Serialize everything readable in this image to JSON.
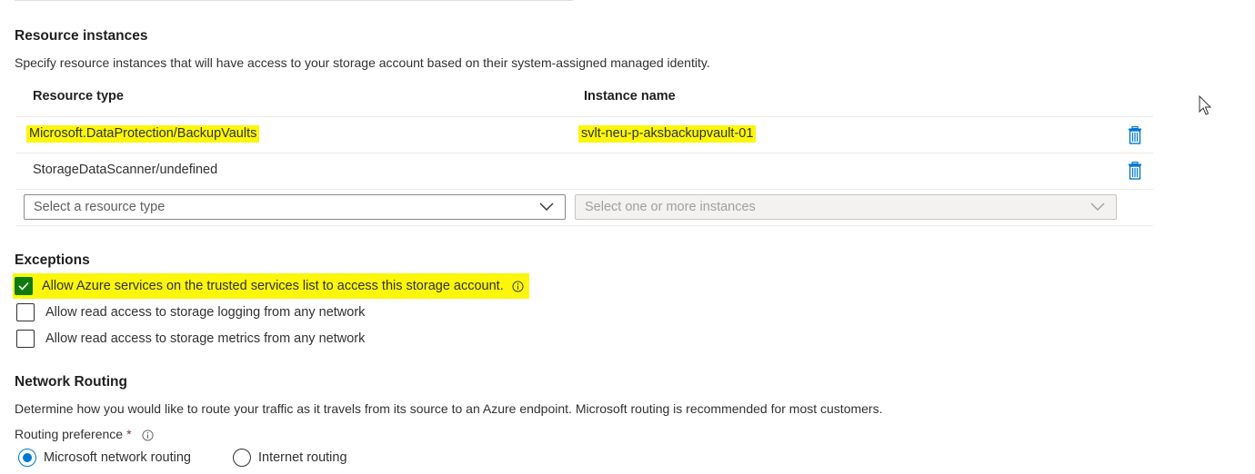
{
  "resource_instances": {
    "heading": "Resource instances",
    "description": "Specify resource instances that will have access to your storage account based on their system-assigned managed identity.",
    "columns": {
      "type": "Resource type",
      "instance": "Instance name"
    },
    "rows": [
      {
        "type": "Microsoft.DataProtection/BackupVaults",
        "instance": "svlt-neu-p-aksbackupvault-01",
        "highlighted": true
      },
      {
        "type": "StorageDataScanner/undefined",
        "instance": "",
        "highlighted": false
      }
    ],
    "type_select_placeholder": "Select a resource type",
    "instance_select_placeholder": "Select one or more instances"
  },
  "exceptions": {
    "heading": "Exceptions",
    "items": [
      {
        "label": "Allow Azure services on the trusted services list to access this storage account.",
        "checked": true,
        "has_info": true,
        "highlighted": true
      },
      {
        "label": "Allow read access to storage logging from any network",
        "checked": false
      },
      {
        "label": "Allow read access to storage metrics from any network",
        "checked": false
      }
    ]
  },
  "network_routing": {
    "heading": "Network Routing",
    "description": "Determine how you would like to route your traffic as it travels from its source to an Azure endpoint. Microsoft routing is recommended for most customers.",
    "preference_label": "Routing preference",
    "required_mark": "*",
    "options": [
      {
        "label": "Microsoft network routing",
        "selected": true
      },
      {
        "label": "Internet routing",
        "selected": false
      }
    ]
  },
  "colors": {
    "accent": "#0078d4",
    "check_green": "#0f7b0f",
    "highlight": "#fbf60a",
    "required": "#a4262c"
  },
  "icons": {
    "delete": "trash-icon",
    "dropdown": "chevron-down-icon",
    "info": "info-icon",
    "check": "checkmark-icon",
    "pointer": "mouse-pointer-icon"
  }
}
